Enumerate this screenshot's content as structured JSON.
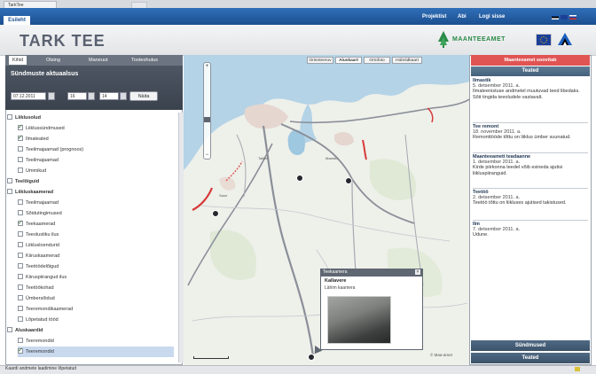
{
  "browser": {
    "tab_title": "TarkTee"
  },
  "topnav": {
    "home": "Esileht",
    "links": [
      "Projektist",
      "Abi",
      "Logi sisse"
    ],
    "languages": [
      "et",
      "en",
      "ru"
    ]
  },
  "header": {
    "title": "TARK TEE",
    "logo_text": "MAANTEEAMET"
  },
  "left": {
    "tabs": [
      "Kihid",
      "Otsing",
      "Marsruut",
      "Tooteohutus"
    ],
    "timefilter": {
      "title": "Sündmuste aktuaalsus",
      "date": "07.12.2011",
      "hour": "16",
      "minute": "14",
      "button": "Näita"
    },
    "tree": [
      {
        "label": "Liiklusolud",
        "level": 0,
        "checked": false,
        "group": true
      },
      {
        "label": "Liiklussündmused",
        "level": 1,
        "checked": true
      },
      {
        "label": "Ilmateated",
        "level": 1,
        "checked": true
      },
      {
        "label": "Teeilmajaamad (prognoos)",
        "level": 1,
        "checked": false
      },
      {
        "label": "Teeilmajaamad",
        "level": 1,
        "checked": false
      },
      {
        "label": "Ummikud",
        "level": 1,
        "checked": false
      },
      {
        "label": "Teelõiguid",
        "level": 0,
        "checked": false,
        "group": true
      },
      {
        "label": "Liikluskaamerad",
        "level": 0,
        "checked": false,
        "group": true
      },
      {
        "label": "Teeilmajaamad",
        "level": 1,
        "checked": false
      },
      {
        "label": "Sõidutingimused",
        "level": 1,
        "checked": false
      },
      {
        "label": "Teekaamerad",
        "level": 1,
        "checked": true
      },
      {
        "label": "Teeolustiku ilus",
        "level": 1,
        "checked": false
      },
      {
        "label": "Liiklusloendurid",
        "level": 1,
        "checked": false
      },
      {
        "label": "Kiiruskaamerad",
        "level": 1,
        "checked": false
      },
      {
        "label": "Teetöödelõigud",
        "level": 1,
        "checked": false
      },
      {
        "label": "Kiiruspiirangud ilus",
        "level": 1,
        "checked": false
      },
      {
        "label": "Teetöökohad",
        "level": 1,
        "checked": false
      },
      {
        "label": "Ümbersõidud",
        "level": 1,
        "checked": false
      },
      {
        "label": "Teeremondikaamerad",
        "level": 1,
        "checked": false
      },
      {
        "label": "Lõpetatud tööd",
        "level": 1,
        "checked": false
      },
      {
        "label": "Aluskaardid",
        "level": 0,
        "checked": false,
        "group": true
      },
      {
        "label": "Teeremondid",
        "level": 1,
        "checked": false
      },
      {
        "label": "Teeremondid",
        "level": 1,
        "checked": true,
        "selected": true
      }
    ]
  },
  "map": {
    "tabs": [
      "Orienteeruv",
      "Aluskaart",
      "Ortofoto",
      "Hübriidkaart"
    ],
    "active_tab": 1,
    "popup": {
      "title": "Teekaamera",
      "camera_name": "Kallavere",
      "description": "Lähim kaamera"
    },
    "attribution": "© Maa-amet"
  },
  "right": {
    "alert": "Maanteeamet soovitab",
    "header": "Teated",
    "events": [
      {
        "title": "Ilmastik",
        "date": "5. detsember 2011. a.",
        "text": "Ilmateenistuse andmetel muutuvad teed libedaks. Sõit tingida teeoludele vastavalt."
      },
      {
        "title": "Tee remont",
        "date": "18. november 2011. a.",
        "text": "Remonttööde tõttu on liiklus ümber suunatud."
      },
      {
        "title": "Maanteeameti teadaanne",
        "date": "1. detsember 2011. a.",
        "text": "Kirde piirkonna teedel võib esineda ajutisi liikluspiiranguid."
      },
      {
        "title": "Teetöö",
        "date": "2. detsember 2011. a.",
        "text": "Teetöö tõttu on liikluses ajutised takistused."
      },
      {
        "title": "Ilm",
        "date": "7. detsember 2011. a.",
        "text": "Udune."
      }
    ],
    "footer": [
      "Sündmused",
      "Teated"
    ]
  },
  "status": {
    "text": "Kaardi andmete laadimine lõpetatud"
  },
  "colors": {
    "nav": "#1d4f91",
    "alert": "#e05454",
    "accent_green": "#2a8a46"
  }
}
